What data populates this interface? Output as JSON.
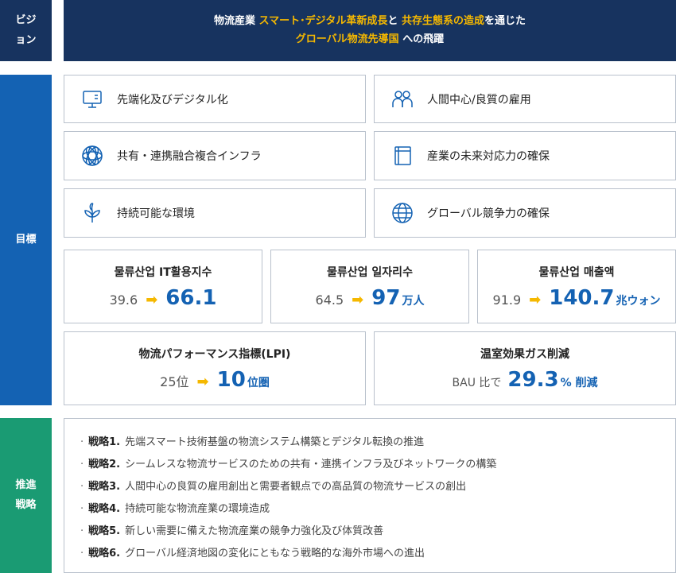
{
  "sections": {
    "vision_label": "ビジョン",
    "goal_label": "目標",
    "strategy_label": "推進戦略"
  },
  "vision": {
    "line1_a": "物流産業 ",
    "line1_hl1": "スマート･デジタル革新成長",
    "line1_b": "と ",
    "line1_hl2": "共存生態系の造成",
    "line1_c": "を通じた",
    "line2_hl": "グローバル物流先導国",
    "line2_b": " への飛躍"
  },
  "goals": [
    {
      "label": "先端化及びデジタル化",
      "icon": "monitor-icon"
    },
    {
      "label": "人間中心/良質の雇用",
      "icon": "people-icon"
    },
    {
      "label": "共有・連携融合複合インフラ",
      "icon": "network-icon"
    },
    {
      "label": "産業の未来対応力の確保",
      "icon": "book-icon"
    },
    {
      "label": "持続可能な環境",
      "icon": "sprout-icon"
    },
    {
      "label": "グローバル競争力の確保",
      "icon": "globe-icon"
    }
  ],
  "metrics": [
    {
      "title": "물류산업 IT활용지수",
      "from": "39.6",
      "to": "66.1",
      "unit": ""
    },
    {
      "title": "물류산업 일자리수",
      "from": "64.5",
      "to": "97",
      "unit": "万人"
    },
    {
      "title": "물류산업 매출액",
      "from": "91.9",
      "to": "140.7",
      "unit": "兆ウォン"
    }
  ],
  "metrics2": [
    {
      "title": "物流パフォーマンス指標(LPI)",
      "from": "25位",
      "to": "10",
      "unit": "位圏"
    },
    {
      "title": "温室効果ガス削減",
      "prefix": "BAU 比で",
      "to": "29.3",
      "unit": "% 削減"
    }
  ],
  "strategies": [
    {
      "num": "戦略1.",
      "text": "先端スマート技術基盤の物流システム構築とデジタル転換の推進"
    },
    {
      "num": "戦略2.",
      "text": "シームレスな物流サービスのための共有・連携インフラ及びネットワークの構築"
    },
    {
      "num": "戦略3.",
      "text": "人間中心の良質の雇用創出と需要者観点での高品質の物流サービスの創出"
    },
    {
      "num": "戦略4.",
      "text": "持続可能な物流産業の環境造成"
    },
    {
      "num": "戦略5.",
      "text": "新しい需要に備えた物流産業の競争力強化及び体質改善"
    },
    {
      "num": "戦略6.",
      "text": "グローバル経済地図の変化にともなう戦略的な海外市場への進出"
    }
  ],
  "colors": {
    "navy": "#17335f",
    "blue": "#1462b3",
    "green": "#1a9b73",
    "yellow": "#f5b800"
  }
}
